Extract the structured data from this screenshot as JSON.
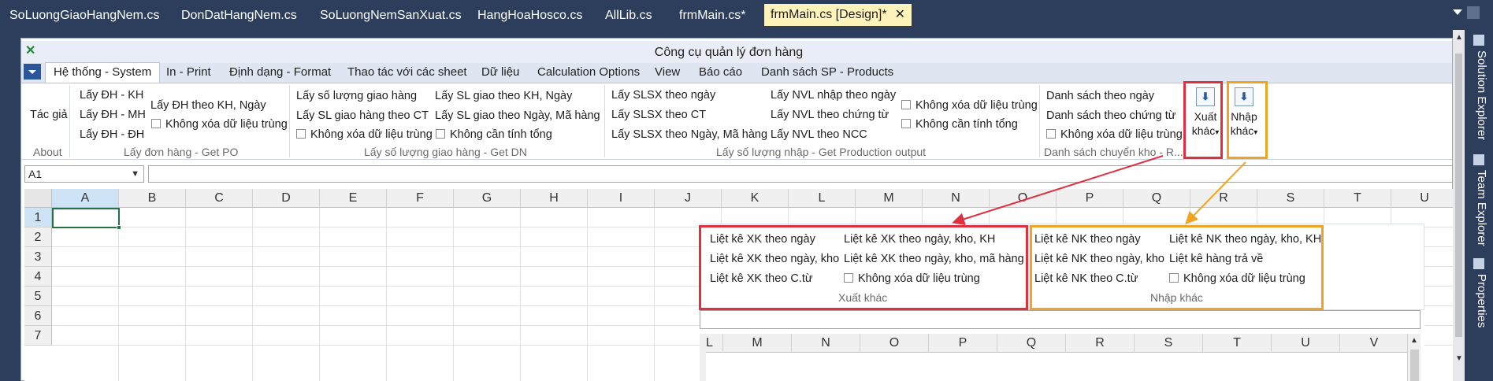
{
  "vs_tabs": [
    {
      "label": "SoLuongGiaoHangNem.cs"
    },
    {
      "label": "DonDatHangNem.cs"
    },
    {
      "label": "SoLuongNemSanXuat.cs"
    },
    {
      "label": "HangHoaHosco.cs"
    },
    {
      "label": "AllLib.cs"
    },
    {
      "label": "frmMain.cs*"
    },
    {
      "label": "frmMain.cs [Design]*"
    }
  ],
  "vs_close_glyph": "✕",
  "side_panel": [
    {
      "label": "Solution Explorer",
      "icon": "solution-explorer-icon"
    },
    {
      "label": "Team Explorer",
      "icon": "team-explorer-icon"
    },
    {
      "label": "Properties",
      "icon": "properties-icon"
    }
  ],
  "window_title": "Công cụ quản lý đơn hàng",
  "ribbon_tabs": [
    {
      "label": "Hệ thống - System"
    },
    {
      "label": "In - Print"
    },
    {
      "label": "Định dạng - Format"
    },
    {
      "label": "Thao tác với các sheet"
    },
    {
      "label": "Dữ liệu"
    },
    {
      "label": "Calculation Options"
    },
    {
      "label": "View"
    },
    {
      "label": "Báo cáo"
    },
    {
      "label": "Danh sách SP - Products"
    }
  ],
  "ribbon": {
    "about": {
      "button": "Tác giả",
      "label": "About"
    },
    "get_po": {
      "items": [
        "Lấy ĐH - KH",
        "Lấy ĐH - MH",
        "Lấy ĐH - ĐH",
        "Lấy ĐH theo KH, Ngày"
      ],
      "checkbox": "Không xóa dữ liệu trùng",
      "label": "Lấy đơn hàng - Get PO"
    },
    "get_dn": {
      "items": [
        "Lấy số lượng giao hàng",
        "Lấy SL giao hàng theo CT",
        "Lấy SL giao theo KH, Ngày",
        "Lấy SL giao theo Ngày, Mã hàng"
      ],
      "checkbox_1": "Không xóa dữ liệu trùng",
      "checkbox_2": "Không cần tính tổng",
      "label": "Lấy số lượng giao hàng - Get  DN"
    },
    "production": {
      "items": [
        "Lấy SLSX theo ngày",
        "Lấy SLSX theo CT",
        "Lấy SLSX theo Ngày, Mã hàng",
        "Lấy NVL nhập theo ngày",
        "Lấy NVL theo chứng từ",
        "Lấy NVL theo NCC"
      ],
      "checkbox_1": "Không xóa dữ liệu trùng",
      "checkbox_2": "Không cần tính tổng",
      "label": "Lấy số lượng nhập - Get Production output"
    },
    "stock": {
      "items": [
        "Danh sách theo ngày",
        "Danh sách theo chứng từ"
      ],
      "checkbox": "Không xóa dữ liệu trùng",
      "label": "Danh sách chuyển kho - R...",
      "xuat_khac": {
        "line1": "Xuất",
        "line2": "khác"
      },
      "nhap_khac": {
        "line1": "Nhập",
        "line2": "khác"
      },
      "dropdown_glyph": "▾"
    }
  },
  "name_box": "A1",
  "columns": [
    "A",
    "B",
    "C",
    "D",
    "E",
    "F",
    "G",
    "H",
    "I",
    "J",
    "K",
    "L",
    "M",
    "N",
    "O",
    "P",
    "Q",
    "R",
    "S",
    "T",
    "U"
  ],
  "rows": [
    "1",
    "2",
    "3",
    "4",
    "5",
    "6",
    "7"
  ],
  "zoom": {
    "xuat_khac": {
      "items": [
        "Liệt kê XK theo ngày",
        "Liệt kê XK theo ngày, kho",
        "Liệt kê XK theo C.từ",
        "Liệt kê XK theo ngày, kho, KH",
        "Liệt kê XK theo ngày, kho, mã hàng"
      ],
      "checkbox": "Không xóa dữ liệu trùng",
      "label": "Xuất khác"
    },
    "nhap_khac": {
      "items": [
        "Liệt kê NK theo ngày",
        "Liệt kê NK theo ngày, kho",
        "Liệt kê NK theo C.từ",
        "Liệt kê NK theo ngày, kho, KH",
        "Liệt kê hàng trả về"
      ],
      "checkbox": "Không xóa dữ liệu trùng",
      "label": "Nhập khác"
    },
    "columns": [
      "L",
      "M",
      "N",
      "O",
      "P",
      "Q",
      "R",
      "S",
      "T",
      "U",
      "V"
    ]
  },
  "colors": {
    "highlight_red": "#e03040",
    "highlight_orange": "#f0a422",
    "vs_frame": "#2d3e5c",
    "active_tab": "#fff3bc"
  }
}
